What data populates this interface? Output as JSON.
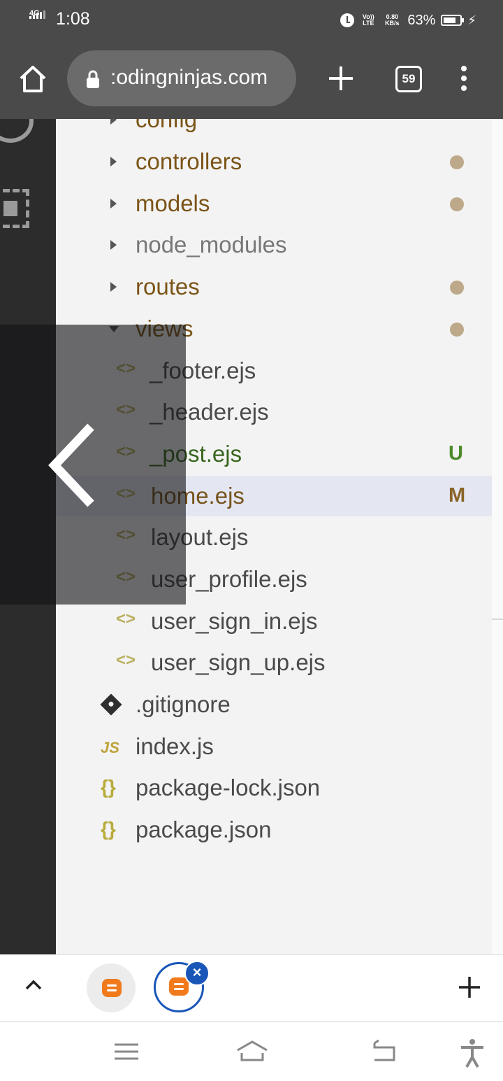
{
  "status_bar": {
    "network": "4G",
    "time": "1:08",
    "volte": "Vo)) LTE",
    "speed": "0.80 KB/s",
    "battery_pct": "63%"
  },
  "toolbar": {
    "url": ":odingninjas.com",
    "tab_count": "59"
  },
  "explorer": {
    "partial_top_folder": "config",
    "folders": [
      {
        "label": "controllers",
        "modified": true
      },
      {
        "label": "models",
        "modified": true
      },
      {
        "label": "node_modules",
        "modified": false
      },
      {
        "label": "routes",
        "modified": true
      },
      {
        "label": "views",
        "modified": true,
        "expanded": true
      }
    ],
    "view_files": [
      {
        "label": "_footer.ejs",
        "status": ""
      },
      {
        "label": "_header.ejs",
        "status": ""
      },
      {
        "label": "_post.ejs",
        "status": "U"
      },
      {
        "label": "home.ejs",
        "status": "M",
        "selected": true
      },
      {
        "label": "layout.ejs",
        "status": ""
      },
      {
        "label": "user_profile.ejs",
        "status": ""
      },
      {
        "label": "user_sign_in.ejs",
        "status": ""
      },
      {
        "label": "user_sign_up.ejs",
        "status": ""
      }
    ],
    "root_files": [
      {
        "label": ".gitignore",
        "icon": "git-icon"
      },
      {
        "label": "index.js",
        "icon": "js-icon",
        "icon_text": "JS"
      },
      {
        "label": "package-lock.json",
        "icon": "json-icon",
        "icon_text": "{}"
      },
      {
        "label": "package.json",
        "icon": "json-icon",
        "icon_text": "{}"
      }
    ],
    "ejs_icon_text": "<>"
  },
  "tab_strip": {
    "close_symbol": "×"
  },
  "colors": {
    "chrome": "#4a4a4a",
    "accent_blue": "#1a56b8",
    "logo_orange": "#f07a1c"
  }
}
